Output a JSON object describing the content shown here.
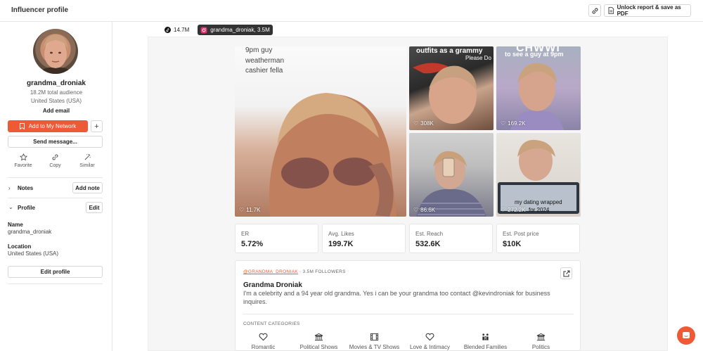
{
  "header": {
    "title": "Influencer profile",
    "unlock_label": "Unlock report & save as PDF"
  },
  "profile": {
    "username": "grandma_droniak",
    "audience": "18.2M total audience",
    "country": "United States (USA)",
    "add_email": "Add email",
    "add_network": "Add to My Network",
    "send_message": "Send message...",
    "actions": [
      {
        "label": "Favorite"
      },
      {
        "label": "Copy"
      },
      {
        "label": "Similar"
      }
    ],
    "notes_label": "Notes",
    "add_note": "Add note",
    "profile_label": "Profile",
    "edit": "Edit",
    "name_label": "Name",
    "name_value": "grandma_droniak",
    "location_label": "Location",
    "location_value": "United States (USA)",
    "edit_profile": "Edit profile"
  },
  "platforms": [
    {
      "label": "14.7M",
      "icon": "tiktok-icon"
    },
    {
      "label": "grandma_droniak,  3.5M",
      "icon": "instagram-icon"
    }
  ],
  "posts": [
    {
      "likes": "11.7K",
      "caption": [
        "9pm guy",
        "weatherman",
        "cashier fella"
      ]
    },
    {
      "likes": "308K",
      "caption": [
        "outfits as a grammy",
        "Please Do"
      ]
    },
    {
      "likes": "169.2K",
      "caption": [
        "CHWWI",
        "to see a guy at 9pm"
      ]
    },
    {
      "likes": "86.6K",
      "caption": []
    },
    {
      "likes": "272.2K",
      "caption": [
        "my dating wrapped",
        "for 2024"
      ]
    }
  ],
  "stats": [
    {
      "label": "ER",
      "value": "5.72%"
    },
    {
      "label": "Avg. Likes",
      "value": "199.7K"
    },
    {
      "label": "Est. Reach",
      "value": "532.6K"
    },
    {
      "label": "Est. Post price",
      "value": "$10K"
    }
  ],
  "account": {
    "handle": "@GRANDMA_DRONIAK",
    "followers": " · 3.5M FOLLOWERS",
    "display_name": "Grandma Droniak",
    "bio": "I'm a celebrity and a 94 year old grandma. Yes i can be your grandma too contact @kevindroniak for business inquires.",
    "categories_label": "CONTENT CATEGORIES",
    "categories": [
      {
        "label": "Romantic",
        "icon": "heart-icon"
      },
      {
        "label": "Political Shows",
        "icon": "bank-icon"
      },
      {
        "label": "Movies & TV Shows",
        "icon": "film-icon"
      },
      {
        "label": "Love & Intimacy",
        "icon": "heart-icon"
      },
      {
        "label": "Blended Families",
        "icon": "family-icon"
      },
      {
        "label": "Politics",
        "icon": "bank-icon"
      }
    ]
  },
  "colors": {
    "accent": "#ef5a36"
  }
}
